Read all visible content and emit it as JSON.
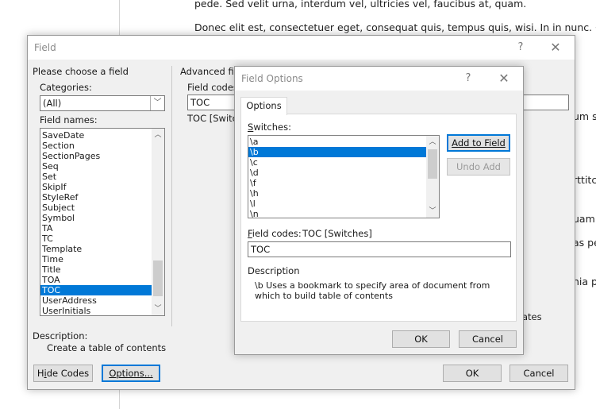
{
  "document": {
    "line1": "pede. Sed velit urna, interdum vel, ultricies vel, faucibus at, quam.",
    "line2": "Donec elit est, consectetuer eget, consequat quis, tempus quis, wisi. In in nunc. Class",
    "frag_um_sc": "um sc",
    "frag_rttitc": "rttitc",
    "frag_uam": "uam",
    "frag_as_pe": "as pe",
    "frag_nia_pu": "nia pu"
  },
  "field_dialog": {
    "title": "Field",
    "help": "?",
    "close": "✕",
    "choose_heading": "Please choose a field",
    "categories_label": "Categories:",
    "categories_value": "(All)",
    "field_names_label": "Field names:",
    "field_names": [
      "SaveDate",
      "Section",
      "SectionPages",
      "Seq",
      "Set",
      "SkipIf",
      "StyleRef",
      "Subject",
      "Symbol",
      "TA",
      "TC",
      "Template",
      "Time",
      "Title",
      "TOA",
      "TOC",
      "UserAddress",
      "UserInitials"
    ],
    "selected_field": "TOC",
    "advanced_label": "Advanced fiel",
    "field_codes_label": "Field codes:",
    "field_codes_value": "TOC",
    "field_codes_hint": "TOC [Switch",
    "behind_fragment": "ates",
    "description_label": "Description:",
    "description_text": "Create a table of contents",
    "hide_codes_button": "Hide Codes",
    "options_button": "Options...",
    "ok_button": "OK",
    "cancel_button": "Cancel"
  },
  "options_dialog": {
    "title": "Field Options",
    "help": "?",
    "close": "✕",
    "tab_label": "Options",
    "switches_label": "Switches:",
    "switches": [
      "\\a",
      "\\b",
      "\\c",
      "\\d",
      "\\f",
      "\\h",
      "\\l",
      "\\n"
    ],
    "selected_switch": "\\b",
    "add_to_field_button": "Add to Field",
    "undo_add_button": "Undo Add",
    "field_codes_label": "Field codes:",
    "field_codes_syntax": "TOC [Switches]",
    "field_codes_value": "TOC",
    "description_label": "Description",
    "description_text": "\\b Uses a bookmark to specify area of document from which to build table of contents",
    "ok_button": "OK",
    "cancel_button": "Cancel"
  },
  "colors": {
    "selection": "#0078d7",
    "dialog_bg": "#f0f0f0",
    "titlebar_bg": "#ffffff"
  }
}
